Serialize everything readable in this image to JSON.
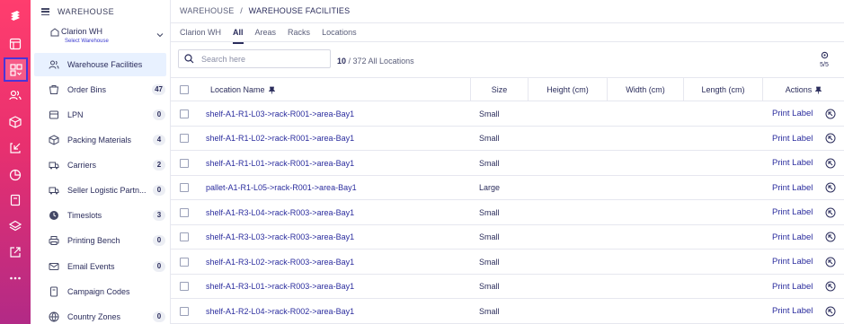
{
  "rail": {
    "icons": [
      "logo-icon",
      "layout-icon",
      "apps-icon",
      "users-icon",
      "box-icon",
      "inbound-icon",
      "chart-icon",
      "document-icon",
      "layers-icon",
      "external-link-icon",
      "more-icon"
    ]
  },
  "sidebar": {
    "title": "WAREHOUSE",
    "warehouse_name": "Clarion WH",
    "warehouse_sub": "Select Warehouse",
    "items": [
      {
        "label": "Warehouse Facilities",
        "count": "",
        "icon": "users-icon"
      },
      {
        "label": "Order Bins",
        "count": "47",
        "icon": "bin-icon"
      },
      {
        "label": "LPN",
        "count": "0",
        "icon": "lpn-icon"
      },
      {
        "label": "Packing Materials",
        "count": "4",
        "icon": "box-icon"
      },
      {
        "label": "Carriers",
        "count": "2",
        "icon": "truck-icon"
      },
      {
        "label": "Seller Logistic Partn...",
        "count": "0",
        "icon": "partner-icon"
      },
      {
        "label": "Timeslots",
        "count": "3",
        "icon": "clock-icon"
      },
      {
        "label": "Printing Bench",
        "count": "0",
        "icon": "printer-icon"
      },
      {
        "label": "Email Events",
        "count": "0",
        "icon": "mail-icon"
      },
      {
        "label": "Campaign Codes",
        "count": "",
        "icon": "tag-icon"
      },
      {
        "label": "Country Zones",
        "count": "0",
        "icon": "globe-icon"
      }
    ]
  },
  "breadcrumb": {
    "root": "WAREHOUSE",
    "separator": "/",
    "current": "WAREHOUSE FACILITIES"
  },
  "tabs": [
    "Clarion WH",
    "All",
    "Areas",
    "Racks",
    "Locations"
  ],
  "active_tab": "All",
  "search": {
    "placeholder": "Search here",
    "value": ""
  },
  "count": {
    "shown": "10",
    "label": "/ 372 All Locations"
  },
  "settings_label": "5/5",
  "table": {
    "columns": [
      "Location Name",
      "Size",
      "Height (cm)",
      "Width (cm)",
      "Length (cm)",
      "Actions"
    ],
    "action_label": "Print Label",
    "rows": [
      {
        "location": "shelf-A1-R1-L03->rack-R001->area-Bay1",
        "size": "Small"
      },
      {
        "location": "shelf-A1-R1-L02->rack-R001->area-Bay1",
        "size": "Small"
      },
      {
        "location": "shelf-A1-R1-L01->rack-R001->area-Bay1",
        "size": "Small"
      },
      {
        "location": "pallet-A1-R1-L05->rack-R001->area-Bay1",
        "size": "Large"
      },
      {
        "location": "shelf-A1-R3-L04->rack-R003->area-Bay1",
        "size": "Small"
      },
      {
        "location": "shelf-A1-R3-L03->rack-R003->area-Bay1",
        "size": "Small"
      },
      {
        "location": "shelf-A1-R3-L02->rack-R003->area-Bay1",
        "size": "Small"
      },
      {
        "location": "shelf-A1-R3-L01->rack-R003->area-Bay1",
        "size": "Small"
      },
      {
        "location": "shelf-A1-R2-L04->rack-R002->area-Bay1",
        "size": "Small"
      }
    ]
  }
}
